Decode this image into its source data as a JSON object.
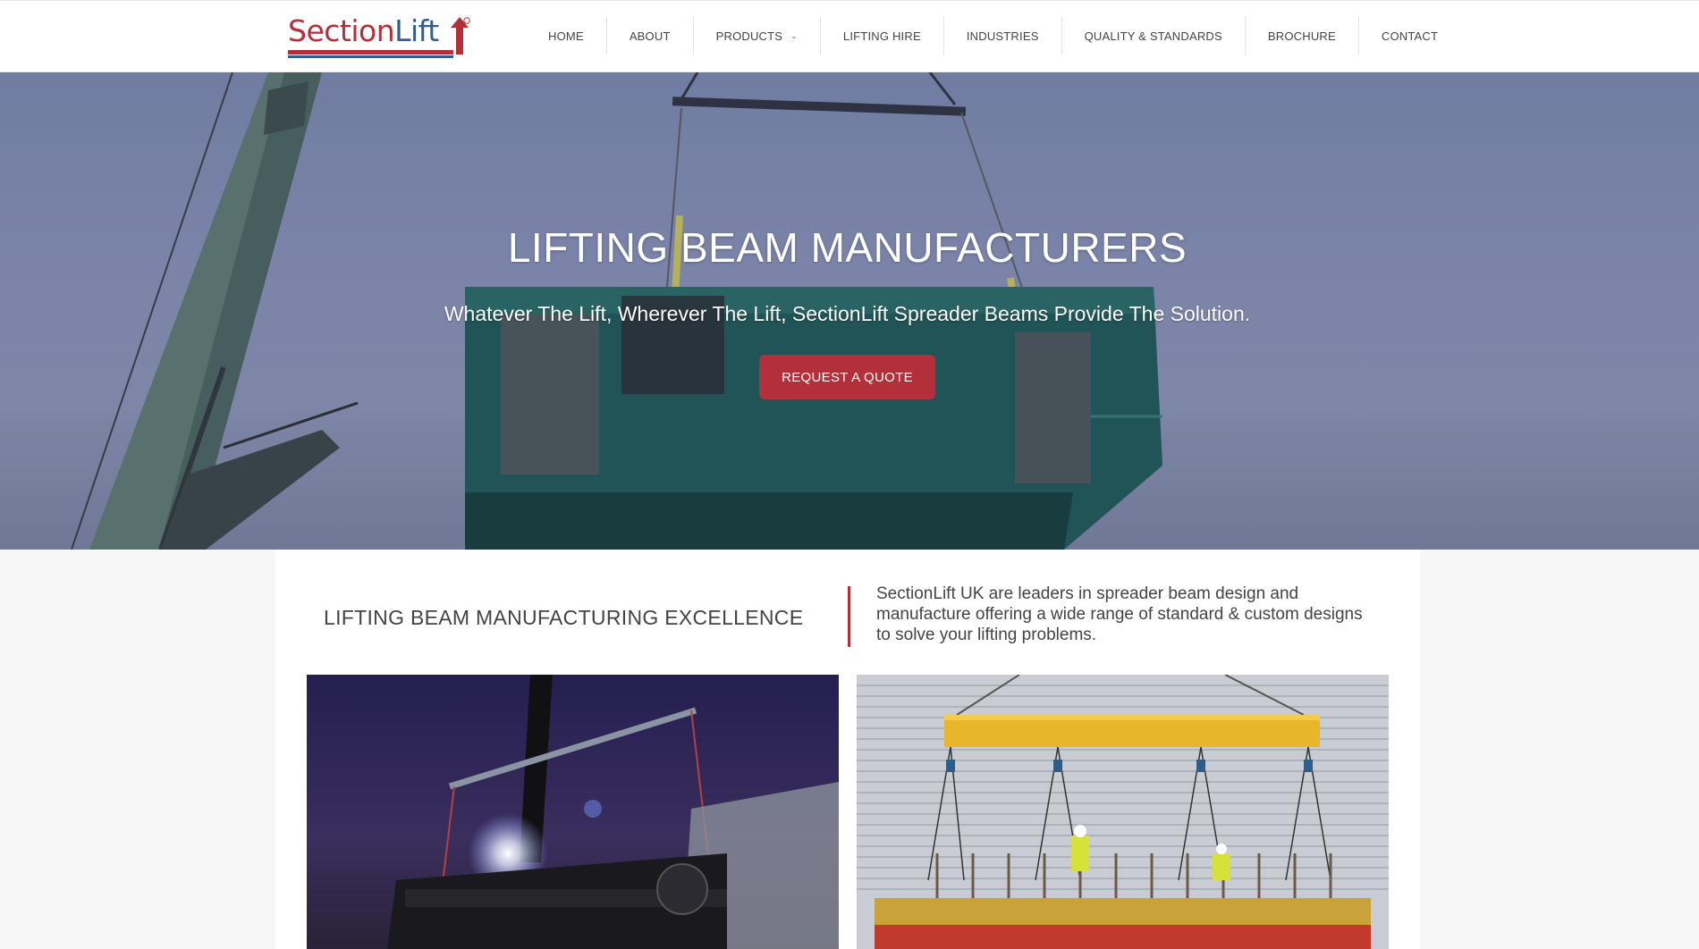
{
  "logo": {
    "text_part1": "Section",
    "text_part2": "Lift",
    "registered": "®",
    "colors": {
      "red": "#b3303b",
      "blue": "#2f5f91"
    }
  },
  "nav": {
    "items": [
      {
        "label": "HOME"
      },
      {
        "label": "ABOUT"
      },
      {
        "label": "PRODUCTS",
        "has_dropdown": true
      },
      {
        "label": "LIFTING HIRE"
      },
      {
        "label": "INDUSTRIES"
      },
      {
        "label": "QUALITY & STANDARDS"
      },
      {
        "label": "BROCHURE"
      },
      {
        "label": "CONTACT"
      }
    ],
    "dropdown_icon": "chevron-down-icon"
  },
  "hero": {
    "title": "LIFTING BEAM MANUFACTURERS",
    "subtitle": "Whatever The Lift, Wherever The Lift, SectionLift Spreader Beams Provide The Solution.",
    "cta_label": "REQUEST A QUOTE"
  },
  "intro": {
    "heading": "LIFTING BEAM MANUFACTURING EXCELLENCE",
    "text": "SectionLift UK are leaders in spreader beam design and manufacture offering a wide range of standard & custom designs to solve your lifting problems."
  },
  "theme": {
    "accent": "#b3303b",
    "nav_text": "#444444",
    "header_bg": "#ffffff",
    "page_bg": "#f7f7f7"
  }
}
